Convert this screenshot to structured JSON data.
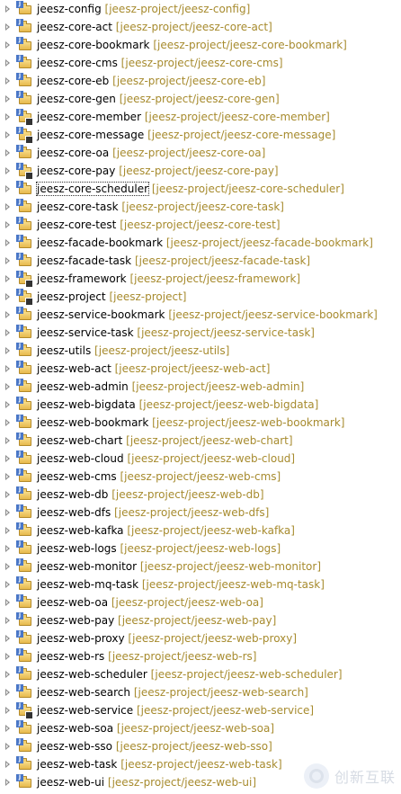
{
  "tree": {
    "items": [
      {
        "name": "jeesz-config",
        "repo": "[jeesz-project/jeesz-config]",
        "warn": false,
        "selected": false
      },
      {
        "name": "jeesz-core-act",
        "repo": "[jeesz-project/jeesz-core-act]",
        "warn": false,
        "selected": false
      },
      {
        "name": "jeesz-core-bookmark",
        "repo": "[jeesz-project/jeesz-core-bookmark]",
        "warn": false,
        "selected": false
      },
      {
        "name": "jeesz-core-cms",
        "repo": "[jeesz-project/jeesz-core-cms]",
        "warn": false,
        "selected": false
      },
      {
        "name": "jeesz-core-eb",
        "repo": "[jeesz-project/jeesz-core-eb]",
        "warn": false,
        "selected": false
      },
      {
        "name": "jeesz-core-gen",
        "repo": "[jeesz-project/jeesz-core-gen]",
        "warn": false,
        "selected": false
      },
      {
        "name": "jeesz-core-member",
        "repo": "[jeesz-project/jeesz-core-member]",
        "warn": true,
        "selected": false
      },
      {
        "name": "jeesz-core-message",
        "repo": "[jeesz-project/jeesz-core-message]",
        "warn": true,
        "selected": false
      },
      {
        "name": "jeesz-core-oa",
        "repo": "[jeesz-project/jeesz-core-oa]",
        "warn": false,
        "selected": false
      },
      {
        "name": "jeesz-core-pay",
        "repo": "[jeesz-project/jeesz-core-pay]",
        "warn": true,
        "selected": false
      },
      {
        "name": "jeesz-core-scheduler",
        "repo": "[jeesz-project/jeesz-core-scheduler]",
        "warn": false,
        "selected": true
      },
      {
        "name": "jeesz-core-task",
        "repo": "[jeesz-project/jeesz-core-task]",
        "warn": false,
        "selected": false
      },
      {
        "name": "jeesz-core-test",
        "repo": "[jeesz-project/jeesz-core-test]",
        "warn": false,
        "selected": false
      },
      {
        "name": "jeesz-facade-bookmark",
        "repo": "[jeesz-project/jeesz-facade-bookmark]",
        "warn": false,
        "selected": false
      },
      {
        "name": "jeesz-facade-task",
        "repo": "[jeesz-project/jeesz-facade-task]",
        "warn": false,
        "selected": false
      },
      {
        "name": "jeesz-framework",
        "repo": "[jeesz-project/jeesz-framework]",
        "warn": true,
        "selected": false
      },
      {
        "name": "jeesz-project",
        "repo": "[jeesz-project]",
        "warn": true,
        "selected": false
      },
      {
        "name": "jeesz-service-bookmark",
        "repo": "[jeesz-project/jeesz-service-bookmark]",
        "warn": false,
        "selected": false
      },
      {
        "name": "jeesz-service-task",
        "repo": "[jeesz-project/jeesz-service-task]",
        "warn": false,
        "selected": false
      },
      {
        "name": "jeesz-utils",
        "repo": "[jeesz-project/jeesz-utils]",
        "warn": false,
        "selected": false
      },
      {
        "name": "jeesz-web-act",
        "repo": "[jeesz-project/jeesz-web-act]",
        "warn": false,
        "selected": false
      },
      {
        "name": "jeesz-web-admin",
        "repo": "[jeesz-project/jeesz-web-admin]",
        "warn": false,
        "selected": false
      },
      {
        "name": "jeesz-web-bigdata",
        "repo": "[jeesz-project/jeesz-web-bigdata]",
        "warn": false,
        "selected": false
      },
      {
        "name": "jeesz-web-bookmark",
        "repo": "[jeesz-project/jeesz-web-bookmark]",
        "warn": false,
        "selected": false
      },
      {
        "name": "jeesz-web-chart",
        "repo": "[jeesz-project/jeesz-web-chart]",
        "warn": false,
        "selected": false
      },
      {
        "name": "jeesz-web-cloud",
        "repo": "[jeesz-project/jeesz-web-cloud]",
        "warn": false,
        "selected": false
      },
      {
        "name": "jeesz-web-cms",
        "repo": "[jeesz-project/jeesz-web-cms]",
        "warn": false,
        "selected": false
      },
      {
        "name": "jeesz-web-db",
        "repo": "[jeesz-project/jeesz-web-db]",
        "warn": false,
        "selected": false
      },
      {
        "name": "jeesz-web-dfs",
        "repo": "[jeesz-project/jeesz-web-dfs]",
        "warn": false,
        "selected": false
      },
      {
        "name": "jeesz-web-kafka",
        "repo": "[jeesz-project/jeesz-web-kafka]",
        "warn": false,
        "selected": false
      },
      {
        "name": "jeesz-web-logs",
        "repo": "[jeesz-project/jeesz-web-logs]",
        "warn": false,
        "selected": false
      },
      {
        "name": "jeesz-web-monitor",
        "repo": "[jeesz-project/jeesz-web-monitor]",
        "warn": false,
        "selected": false
      },
      {
        "name": "jeesz-web-mq-task",
        "repo": "[jeesz-project/jeesz-web-mq-task]",
        "warn": false,
        "selected": false
      },
      {
        "name": "jeesz-web-oa",
        "repo": "[jeesz-project/jeesz-web-oa]",
        "warn": false,
        "selected": false
      },
      {
        "name": "jeesz-web-pay",
        "repo": "[jeesz-project/jeesz-web-pay]",
        "warn": false,
        "selected": false
      },
      {
        "name": "jeesz-web-proxy",
        "repo": "[jeesz-project/jeesz-web-proxy]",
        "warn": false,
        "selected": false
      },
      {
        "name": "jeesz-web-rs",
        "repo": "[jeesz-project/jeesz-web-rs]",
        "warn": false,
        "selected": false
      },
      {
        "name": "jeesz-web-scheduler",
        "repo": "[jeesz-project/jeesz-web-scheduler]",
        "warn": false,
        "selected": false
      },
      {
        "name": "jeesz-web-search",
        "repo": "[jeesz-project/jeesz-web-search]",
        "warn": false,
        "selected": false
      },
      {
        "name": "jeesz-web-service",
        "repo": "[jeesz-project/jeesz-web-service]",
        "warn": true,
        "selected": false
      },
      {
        "name": "jeesz-web-soa",
        "repo": "[jeesz-project/jeesz-web-soa]",
        "warn": false,
        "selected": false
      },
      {
        "name": "jeesz-web-sso",
        "repo": "[jeesz-project/jeesz-web-sso]",
        "warn": false,
        "selected": false
      },
      {
        "name": "jeesz-web-task",
        "repo": "[jeesz-project/jeesz-web-task]",
        "warn": false,
        "selected": false
      },
      {
        "name": "jeesz-web-ui",
        "repo": "[jeesz-project/jeesz-web-ui]",
        "warn": false,
        "selected": false
      }
    ]
  },
  "watermark": {
    "text": "创新互联",
    "logo_icon": "watermark-logo-icon"
  },
  "colors": {
    "repo_text": "#a78b2e",
    "project_text": "#000000",
    "arrow": "#8a8a8a",
    "badge": "#4a77c7"
  }
}
